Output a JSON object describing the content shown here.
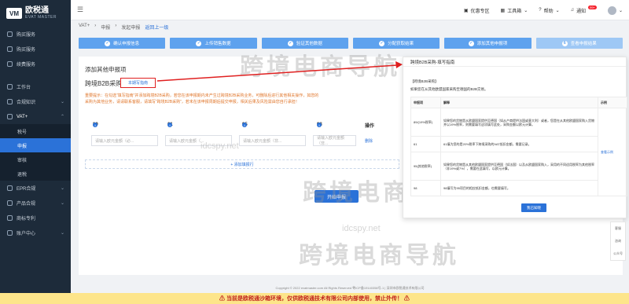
{
  "brand": {
    "name_cn": "欧税通",
    "name_en": "EVAT MASTER",
    "mark": "VM"
  },
  "sidebar": {
    "items": [
      {
        "label": "购买服务",
        "icon": "cart-icon"
      },
      {
        "label": "购买服务",
        "icon": "bag-icon"
      },
      {
        "label": "续费服务",
        "icon": "renew-icon"
      },
      {
        "label": "工作台",
        "icon": "desk-icon"
      },
      {
        "label": "合规知识",
        "icon": "book-icon"
      },
      {
        "label": "VAT+",
        "icon": "vat-icon"
      },
      {
        "label": "税号",
        "icon": ""
      },
      {
        "label": "申报",
        "icon": ""
      },
      {
        "label": "审核",
        "icon": ""
      },
      {
        "label": "退税",
        "icon": ""
      },
      {
        "label": "EPR合规",
        "icon": "epr-icon"
      },
      {
        "label": "产品合规",
        "icon": "product-icon"
      },
      {
        "label": "商标专利",
        "icon": "trademark-icon"
      },
      {
        "label": "账户中心",
        "icon": "account-icon"
      }
    ]
  },
  "topbar": {
    "promo": "优惠专区",
    "tools": "工具箱",
    "help": "帮助",
    "notify": "通知",
    "notify_count": "99+"
  },
  "breadcrumb": {
    "a": "VAT+",
    "b": "申报",
    "c": "发起申报",
    "back": "返回上一级"
  },
  "steps": [
    "确认申报信息",
    "上传销售数据",
    "验证其他数据",
    "分配获取结果",
    "添加其他申报项",
    "查看申报结果"
  ],
  "card": {
    "title": "添加其他申报项",
    "subtitle": "跨境B2B采购",
    "guide_btn": "本期写指南",
    "warning": "重要提示：在勾选“填写指南”并添加跨境B2B采购，若您在该申报期内未产生过跨境B2B采购业务，可删除后进行其他相关操作，如您的采购为其他业务，请请联系客服，请填写“跨境B2B采购”，若未在该申报周期后提交申报，相关后果及风险需由您自行承担！",
    "cols": [
      "89",
      "61",
      "95",
      "98",
      "操作"
    ],
    "placeholders": [
      "请输入欧元金额（必...",
      "请输入欧元金额（...",
      "请输入欧元金额（非...",
      "请输入欧元金额（非..."
    ],
    "delete": "删除",
    "add_row": "+ 添加填报行",
    "start": "开始申报"
  },
  "panel": {
    "title": "跨境B2B采购-填写指南",
    "heading": "【跨境B2B采购】",
    "desc": "如果您在从其他欧盟国家采购至德国的B2B交易。",
    "th": [
      "申报项",
      "解释",
      "示例"
    ],
    "rows": [
      {
        "code": "89/(19%税率)",
        "desc": "如果您的货物是从欧盟国家提供至德国（如从产商提供法国或意大利）或者，您是在从其他欧盟国家购入货物并以19%税率，则需要填写这项填写此处，采购金额以欧元计算。",
        "ex": "查看示例"
      },
      {
        "code": "61",
        "desc": "61填为您的是20%税率下跨境采购的VAT抵扣金额，需要记录。",
        "ex": ""
      },
      {
        "code": "95(其他税率)",
        "desc": "如果您的货物是从其他欧盟国家提供至德国（如法国）以及从欧盟国家购入，采用的不同适用税率为其他税率（非19%或7%），需要在此填写，以欧元计算。",
        "ex": ""
      },
      {
        "code": "98",
        "desc": "98填写为95项目的相应抵扣金额，也需要填写。",
        "ex": ""
      }
    ],
    "close": "我已知晓"
  },
  "floaters": [
    "客服",
    "咨询",
    "公众号"
  ],
  "footer": "Copyright © 2022 evatmaster.com All Rights Reserved 粤ICP备19140358号-1 | 深圳市欧税通技术有限公司",
  "bottom_notice": "⚠ 当前是欧税通沙箱环境，仅供欧税通技术有限公司内部使用，禁止外传！ ⚠",
  "watermarks": {
    "main": "跨境电商导航",
    "url": "idcspy.net"
  }
}
